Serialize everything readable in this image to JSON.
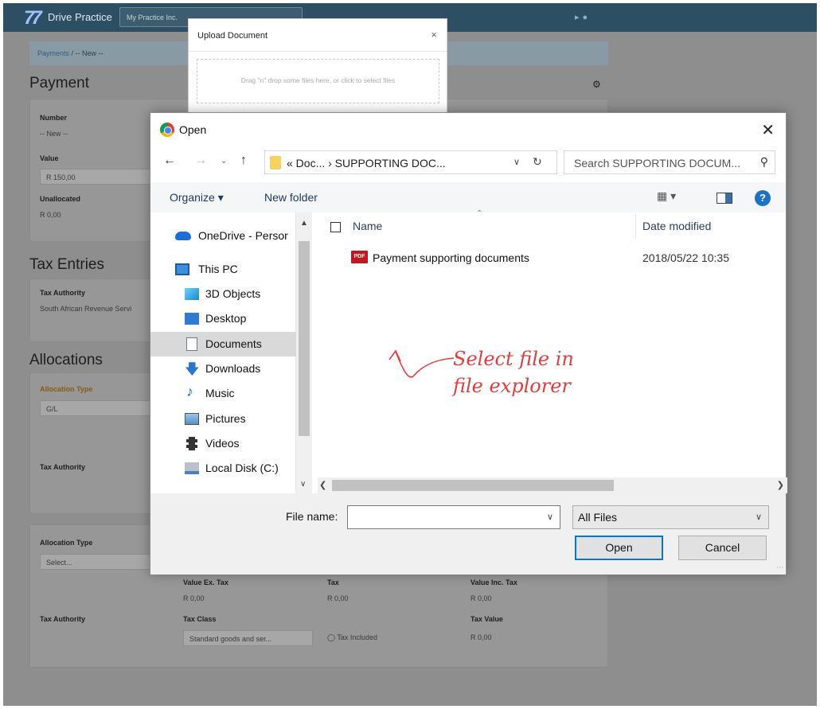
{
  "app": {
    "logo": "Drive Practice",
    "practice": "My Practice Inc.",
    "breadcrumb": {
      "link": "Payments",
      "current": "/ -- New --"
    }
  },
  "payment": {
    "title": "Payment",
    "number_label": "Number",
    "number_value": "-- New --",
    "value_label": "Value",
    "value_value": "R 150,00",
    "unallocated_label": "Unallocated",
    "unallocated_value": "R 0,00"
  },
  "tax_entries": {
    "title": "Tax Entries",
    "authority_label": "Tax Authority",
    "authority_value": "South African Revenue Servi"
  },
  "allocations": {
    "title": "Allocations",
    "alloc1_type_label": "Allocation Type",
    "alloc1_type_value": "G/L",
    "alloc1_tax_authority_label": "Tax Authority",
    "alloc2_type_label": "Allocation Type",
    "alloc2_type_placeholder": "Select...",
    "alloc2_tax_authority_label": "Tax Authority",
    "value_ex_tax_label": "Value Ex. Tax",
    "value_ex_tax": "R 0,00",
    "tax_label": "Tax",
    "tax": "R 0,00",
    "value_inc_tax_label": "Value Inc. Tax",
    "value_inc_tax": "R 0,00",
    "tax_class_label": "Tax Class",
    "tax_class_value": "Standard goods and ser...",
    "tax_included_label": "Tax Included",
    "tax_value_label": "Tax Value",
    "tax_value": "R 0,00"
  },
  "upload_modal": {
    "title": "Upload Document",
    "close": "×",
    "dropzone": "Drag \"n\" drop some files here, or click to select files"
  },
  "open_dialog": {
    "title": "Open",
    "close": "✕",
    "address": "« Doc... › SUPPORTING DOC...",
    "search_placeholder": "Search SUPPORTING DOCUM...",
    "organize": "Organize ▾",
    "new_folder": "New folder",
    "nav_items": [
      {
        "label": "OneDrive - Persor",
        "icon": "cloud-icon"
      },
      {
        "label": "This PC",
        "icon": "computer-icon"
      },
      {
        "label": "3D Objects",
        "icon": "cube-icon"
      },
      {
        "label": "Desktop",
        "icon": "desktop-icon"
      },
      {
        "label": "Documents",
        "icon": "document-icon",
        "selected": true
      },
      {
        "label": "Downloads",
        "icon": "download-icon"
      },
      {
        "label": "Music",
        "icon": "music-icon"
      },
      {
        "label": "Pictures",
        "icon": "picture-icon"
      },
      {
        "label": "Videos",
        "icon": "video-icon"
      },
      {
        "label": "Local Disk (C:)",
        "icon": "disk-icon"
      }
    ],
    "columns": {
      "name": "Name",
      "date": "Date modified"
    },
    "files": [
      {
        "name": "Payment supporting documents",
        "date": "2018/05/22 10:35",
        "icon": "pdf-icon"
      }
    ],
    "annotation_line1": "Select file in",
    "annotation_line2": "file explorer",
    "file_name_label": "File name:",
    "file_name_value": "",
    "file_type": "All Files",
    "open_button": "Open",
    "cancel_button": "Cancel"
  }
}
